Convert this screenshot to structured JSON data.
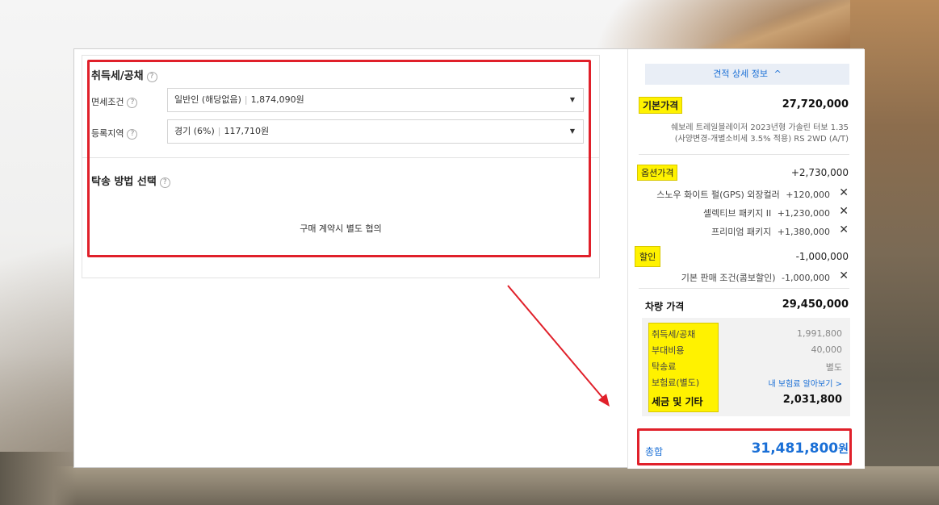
{
  "left": {
    "acquisition": {
      "title": "취득세/공채",
      "help": "?",
      "exemption_label": "면세조건",
      "exemption_value": "일반인 (해당없음)",
      "exemption_amount": "1,874,090원",
      "region_label": "등록지역",
      "region_value": "경기 (6%)",
      "region_amount": "117,710원"
    },
    "delivery": {
      "title": "탁송 방법 선택",
      "note": "구매 계약시 별도 협의"
    }
  },
  "right": {
    "header": "견적 상세 정보",
    "header_icon": "chevron-up-icon",
    "base": {
      "label": "기본가격",
      "amount": "27,720,000",
      "desc1": "쉐보레 트레일블레이저 2023년형 가솔린 터보 1.35",
      "desc2": "(사양변경-개별소비세 3.5% 적용) RS 2WD (A/T)"
    },
    "options": {
      "label": "옵션가격",
      "amount": "+2,730,000",
      "items": [
        {
          "name": "스노우 화이트 펄(GPS) 외장컬러",
          "amount": "+120,000"
        },
        {
          "name": "셀렉티브 패키지 II",
          "amount": "+1,230,000"
        },
        {
          "name": "프리미엄 패키지",
          "amount": "+1,380,000"
        }
      ]
    },
    "discount": {
      "label": "할인",
      "amount": "-1,000,000",
      "items": [
        {
          "name": "기본 판매 조건(콤보할인)",
          "amount": "-1,000,000"
        }
      ]
    },
    "vehicle": {
      "label": "차량 가격",
      "amount": "29,450,000"
    },
    "taxes": {
      "rows": [
        {
          "label": "취득세/공채",
          "value": "1,991,800"
        },
        {
          "label": "부대비용",
          "value": "40,000"
        },
        {
          "label": "탁송료",
          "value": "별도"
        },
        {
          "label": "보험료(별도)",
          "value": "내 보험료 알아보기 >"
        }
      ],
      "total_label": "세금 및 기타",
      "total_amount": "2,031,800"
    },
    "total": {
      "label": "총합",
      "amount": "31,481,800",
      "unit": "원"
    }
  },
  "colors": {
    "highlight": "#fff200",
    "annotation_red": "#e0202a",
    "link_blue": "#1a6fd6",
    "header_bg": "#e9eef6"
  }
}
